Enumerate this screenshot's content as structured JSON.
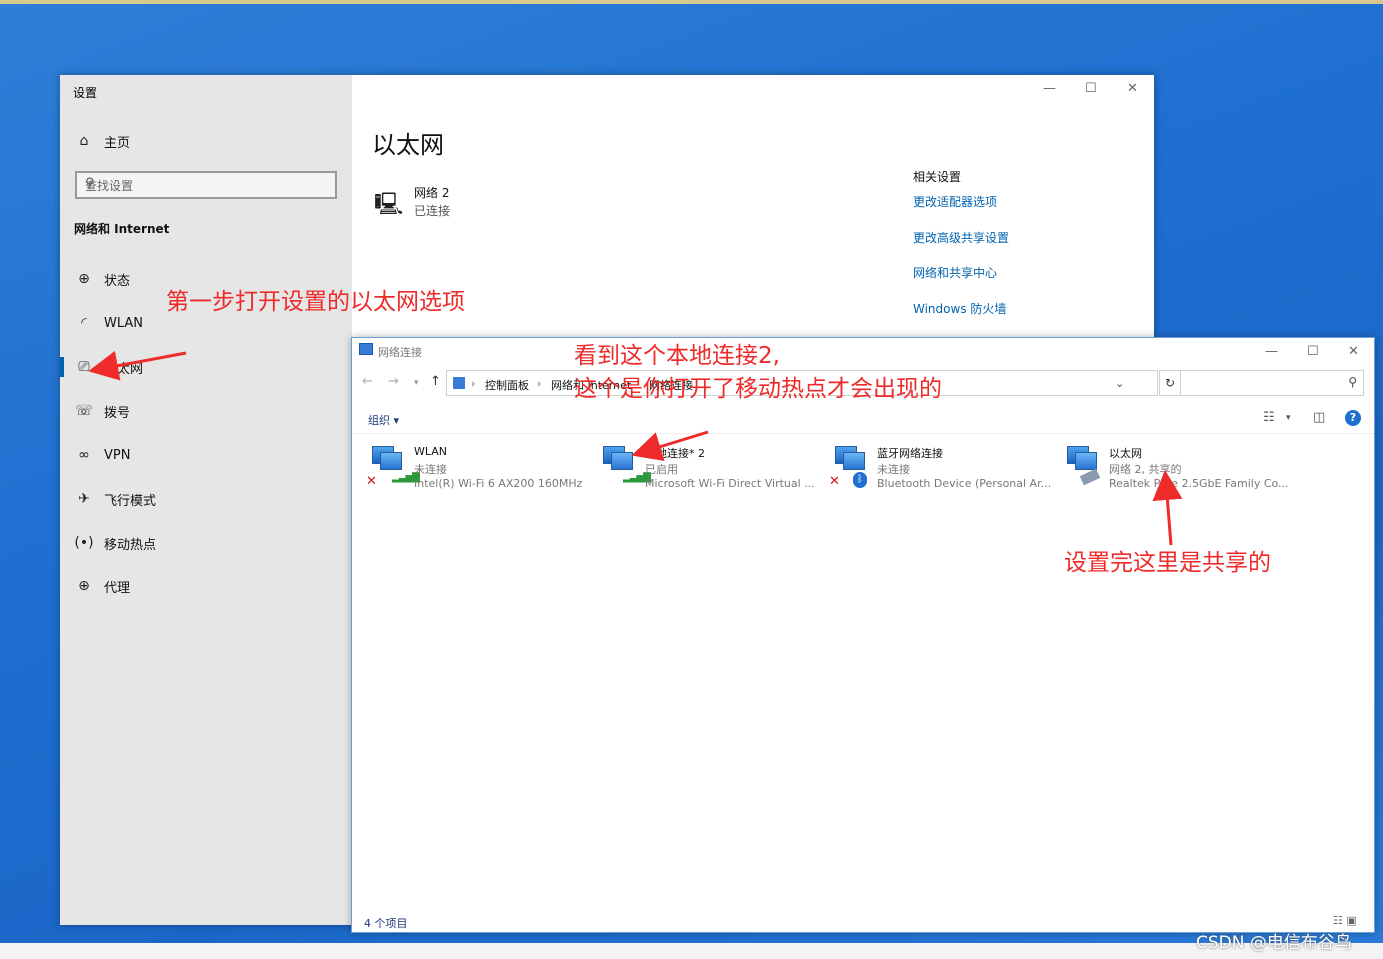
{
  "settings": {
    "window_title": "设置",
    "home": "主页",
    "search_placeholder": "查找设置",
    "category": "网络和 Internet",
    "nav": [
      {
        "label": "状态",
        "icon": "globe-status-icon"
      },
      {
        "label": "WLAN",
        "icon": "wifi-icon"
      },
      {
        "label": "以太网",
        "icon": "ethernet-icon"
      },
      {
        "label": "拨号",
        "icon": "dialup-icon"
      },
      {
        "label": "VPN",
        "icon": "vpn-icon"
      },
      {
        "label": "飞行模式",
        "icon": "airplane-icon"
      },
      {
        "label": "移动热点",
        "icon": "hotspot-icon"
      },
      {
        "label": "代理",
        "icon": "globe-icon"
      }
    ],
    "main_title": "以太网",
    "network": {
      "name": "网络 2",
      "status": "已连接"
    },
    "related_title": "相关设置",
    "related_links": [
      "更改适配器选项",
      "更改高级共享设置",
      "网络和共享中心",
      "Windows 防火墙"
    ]
  },
  "explorer": {
    "window_title": "网络连接",
    "breadcrumb": [
      "控制面板",
      "网络和 Internet",
      "网络连接"
    ],
    "organize": "组织 ▾",
    "items": [
      {
        "name": "WLAN",
        "status": "未连接",
        "device": "Intel(R) Wi-Fi 6 AX200 160MHz"
      },
      {
        "name": "本地连接* 2",
        "status": "已启用",
        "device": "Microsoft Wi-Fi Direct Virtual ..."
      },
      {
        "name": "蓝牙网络连接",
        "status": "未连接",
        "device": "Bluetooth Device (Personal Ar..."
      },
      {
        "name": "以太网",
        "status": "网络 2, 共享的",
        "device": "Realtek PCIe 2.5GbE Family Co..."
      }
    ],
    "status_count": "4 个项目"
  },
  "annotations": {
    "step1": "第一步打开设置的以太网选项",
    "note_line1": "看到这个本地连接2,",
    "note_line2": "这个是你打开了移动热点才会出现的",
    "note_shared": "设置完这里是共享的"
  },
  "watermark": "CSDN @电信布谷鸟",
  "colors": {
    "accent": "#0063b1",
    "annotation": "#ee2a2a",
    "desktop": "#1e6fd0"
  }
}
